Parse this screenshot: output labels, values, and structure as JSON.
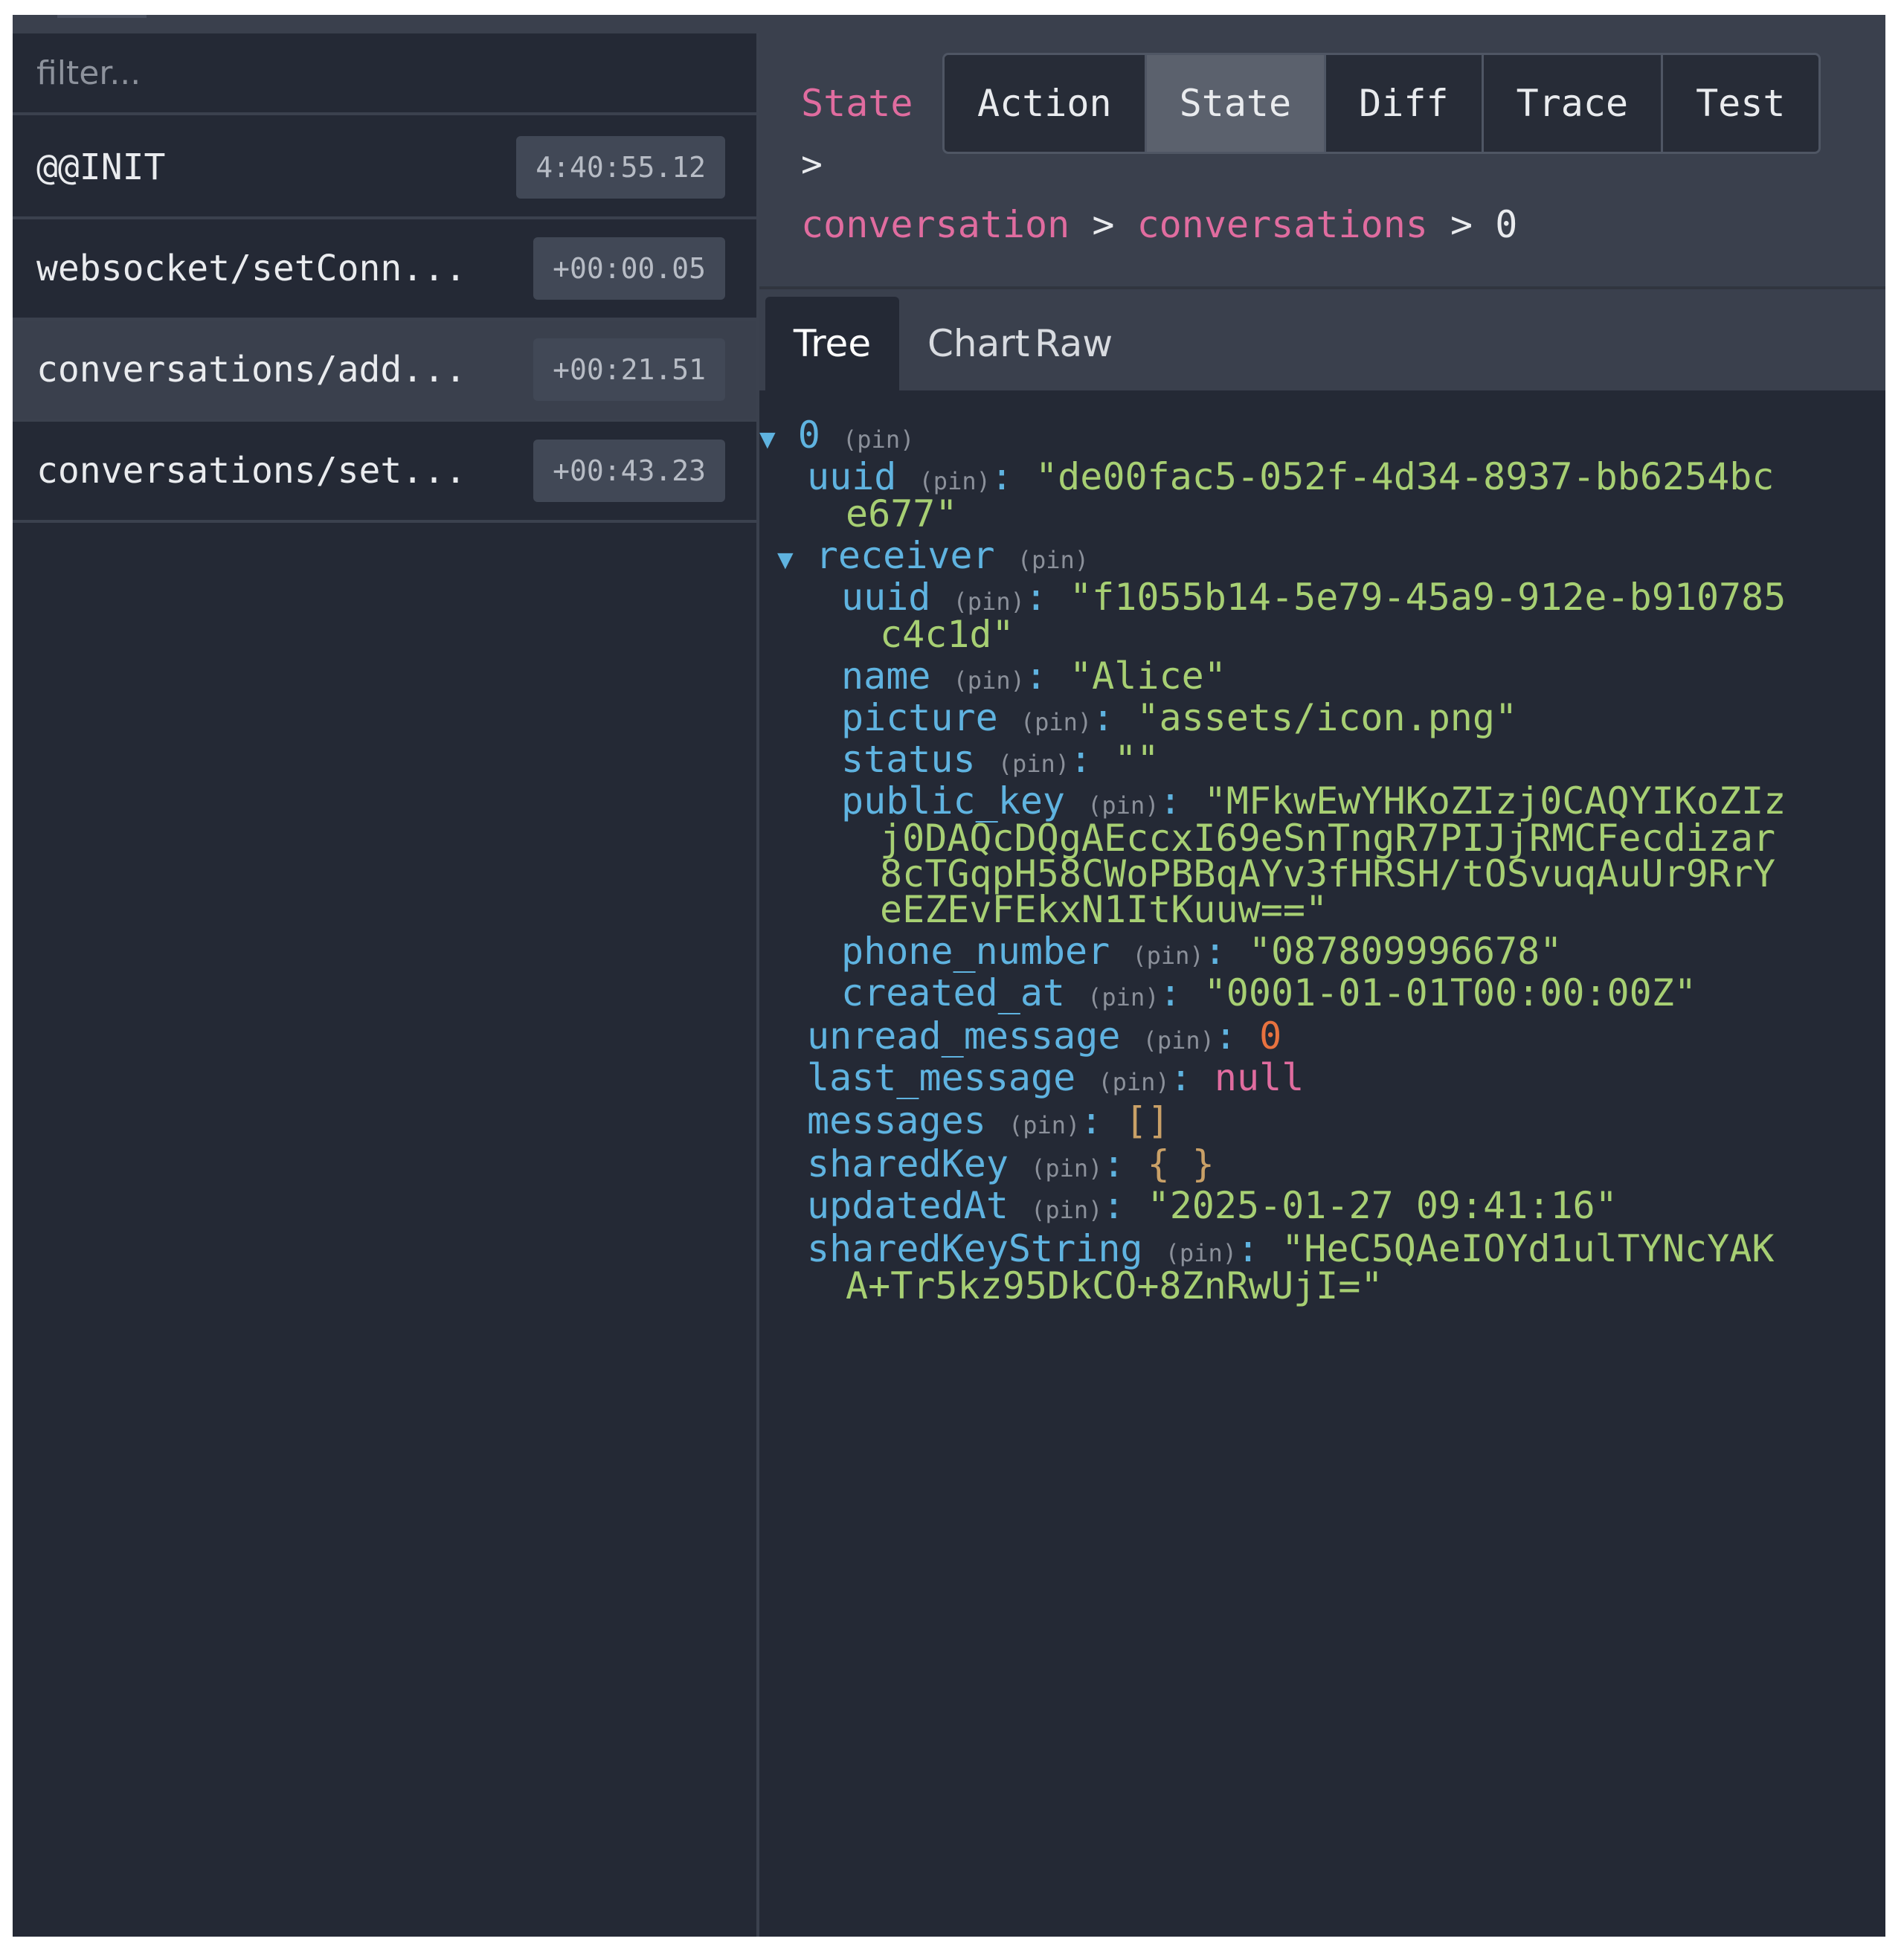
{
  "filter": {
    "placeholder": "filter..."
  },
  "actions": [
    {
      "name": "@@INIT",
      "time": "4:40:55.12"
    },
    {
      "name": "websocket/setConn...",
      "time": "+00:00.05"
    },
    {
      "name": "conversations/add...",
      "time": "+00:21.51"
    },
    {
      "name": "conversations/set...",
      "time": "+00:43.23"
    }
  ],
  "header": {
    "title": "State",
    "separator": ">",
    "path": [
      "conversation",
      "conversations",
      "0"
    ],
    "modes": [
      "Action",
      "State",
      "Diff",
      "Trace",
      "Test"
    ],
    "active_mode": "State"
  },
  "tabs": [
    "Tree",
    "Chart",
    "Raw"
  ],
  "active_tab": "Tree",
  "tree": {
    "pin": "(pin)",
    "root_index": "0",
    "uuid_key": "uuid",
    "uuid_value_1": "\"de00fac5-052f-4d34-8937-bb6254bc",
    "uuid_value_2": "e677\"",
    "receiver_key": "receiver",
    "receiver": {
      "uuid_key": "uuid",
      "uuid_value_1": "\"f1055b14-5e79-45a9-912e-b910785",
      "uuid_value_2": "c4c1d\"",
      "name_key": "name",
      "name_value": "\"Alice\"",
      "picture_key": "picture",
      "picture_value": "\"assets/icon.png\"",
      "status_key": "status",
      "status_value": "\"\"",
      "public_key_key": "public_key",
      "public_key_value_1": "\"MFkwEwYHKoZIzj0CAQYIKoZIz",
      "public_key_value_2": "j0DAQcDQgAEccxI69eSnTngR7PIJjRMCFecdizar",
      "public_key_value_3": "8cTGqpH58CWoPBBqAYv3fHRSH/tOSvuqAuUr9RrY",
      "public_key_value_4": "eEZEvFEkxN1ItKuuw==\"",
      "phone_number_key": "phone_number",
      "phone_number_value": "\"087809996678\"",
      "created_at_key": "created_at",
      "created_at_value": "\"0001-01-01T00:00:00Z\""
    },
    "unread_message_key": "unread_message",
    "unread_message_value": "0",
    "last_message_key": "last_message",
    "last_message_value": "null",
    "messages_key": "messages",
    "messages_value": "[]",
    "sharedKey_key": "sharedKey",
    "sharedKey_value": "{ }",
    "updatedAt_key": "updatedAt",
    "updatedAt_value": "\"2025-01-27 09:41:16\"",
    "sharedKeyString_key": "sharedKeyString",
    "sharedKeyString_value_1": "\"HeC5QAeIOYd1ulTYNcYAK",
    "sharedKeyString_value_2": "A+Tr5kz95DkCO+8ZnRwUjI=\""
  },
  "colors": {
    "background": "#242935",
    "panel": "#3a404d",
    "key": "#5fb3e0",
    "string": "#a7cf73",
    "number": "#e8723f",
    "null": "#e06c9f",
    "breadcrumb_link": "#e06c9f"
  }
}
